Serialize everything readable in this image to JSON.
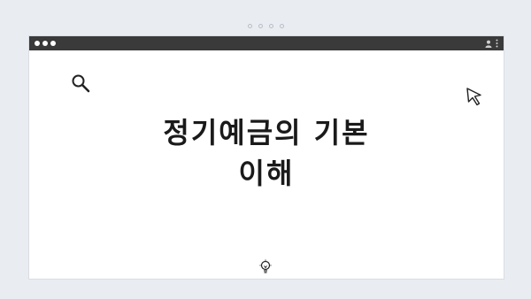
{
  "window": {
    "traffic_lights": [
      "dot",
      "dot",
      "dot"
    ],
    "titlebar_icons": [
      "user-icon",
      "menu-dots-icon"
    ]
  },
  "main": {
    "heading_line1": "정기예금의 기본",
    "heading_line2": "이해"
  },
  "icons": {
    "search": "search-icon",
    "cursor": "cursor-pointer-icon",
    "bulb": "lightbulb-icon"
  },
  "colors": {
    "background": "#e9edf2",
    "titlebar": "#3a3a3a",
    "text": "#1a1a1a"
  }
}
